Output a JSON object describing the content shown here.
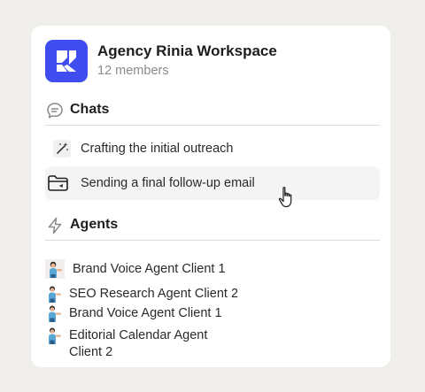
{
  "workspace": {
    "name": "Agency Rinia Workspace",
    "members": "12 members",
    "brand_color": "#3f4cf0"
  },
  "chats": {
    "title": "Chats",
    "icon": "chat-bubble-icon",
    "items": [
      {
        "label": "Crafting the initial outreach",
        "icon": "magic-wand-icon"
      },
      {
        "label": "Sending a final follow-up email",
        "icon": "folder-icon",
        "hovered": true
      }
    ]
  },
  "agents": {
    "title": "Agents",
    "icon": "lightning-icon",
    "items": [
      {
        "label": "Brand Voice Agent Client 1",
        "icon": "agent-avatar-icon"
      },
      {
        "label": "SEO Research Agent Client 2",
        "icon": "agent-avatar-icon"
      },
      {
        "label": "Brand Voice Agent Client 1",
        "icon": "agent-avatar-icon"
      },
      {
        "label": "Editorial Calendar Agent Client 2",
        "icon": "agent-avatar-icon"
      }
    ]
  }
}
